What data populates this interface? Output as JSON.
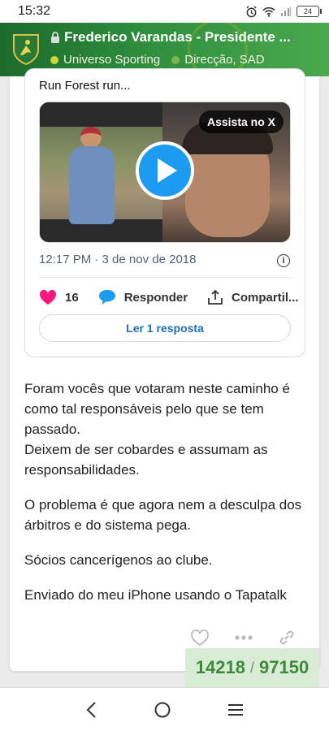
{
  "status_bar": {
    "time": "15:32",
    "battery": "24"
  },
  "header": {
    "title": "Frederico Varandas - Presidente ...",
    "subforum": "Universo Sporting",
    "category": "Direcção, SAD",
    "colors": {
      "primary": "#2f8f3e",
      "subforum_dot": "#c9d83b",
      "category_dot": "#7fb44a"
    }
  },
  "tweet": {
    "text": "Run Forest run...",
    "watch_label": "Assista no X",
    "timestamp": "12:17 PM · 3 de nov de 2018",
    "likes": "16",
    "reply_label": "Responder",
    "share_label": "Compartil...",
    "read_replies_label": "Ler 1 resposta",
    "accent_color": "#1d9bf0"
  },
  "post": {
    "paragraphs": [
      "Foram vocês que votaram neste caminho é como tal responsáveis pelo que se tem passado.\nDeixem de ser cobardes e assumam as responsabilidades.",
      "O problema é que agora nem a desculpa dos árbitros e do sistema pega.",
      "Sócios cancerígenos ao clube.",
      "Enviado do meu iPhone usando o Tapatalk"
    ],
    "icons": [
      "heart-outline-icon",
      "more-icon",
      "link-icon"
    ]
  },
  "counter": {
    "current": "14218",
    "separator": "/",
    "total": "97150"
  },
  "navbar": {
    "icons": [
      "back-icon",
      "home-icon",
      "menu-icon"
    ]
  }
}
